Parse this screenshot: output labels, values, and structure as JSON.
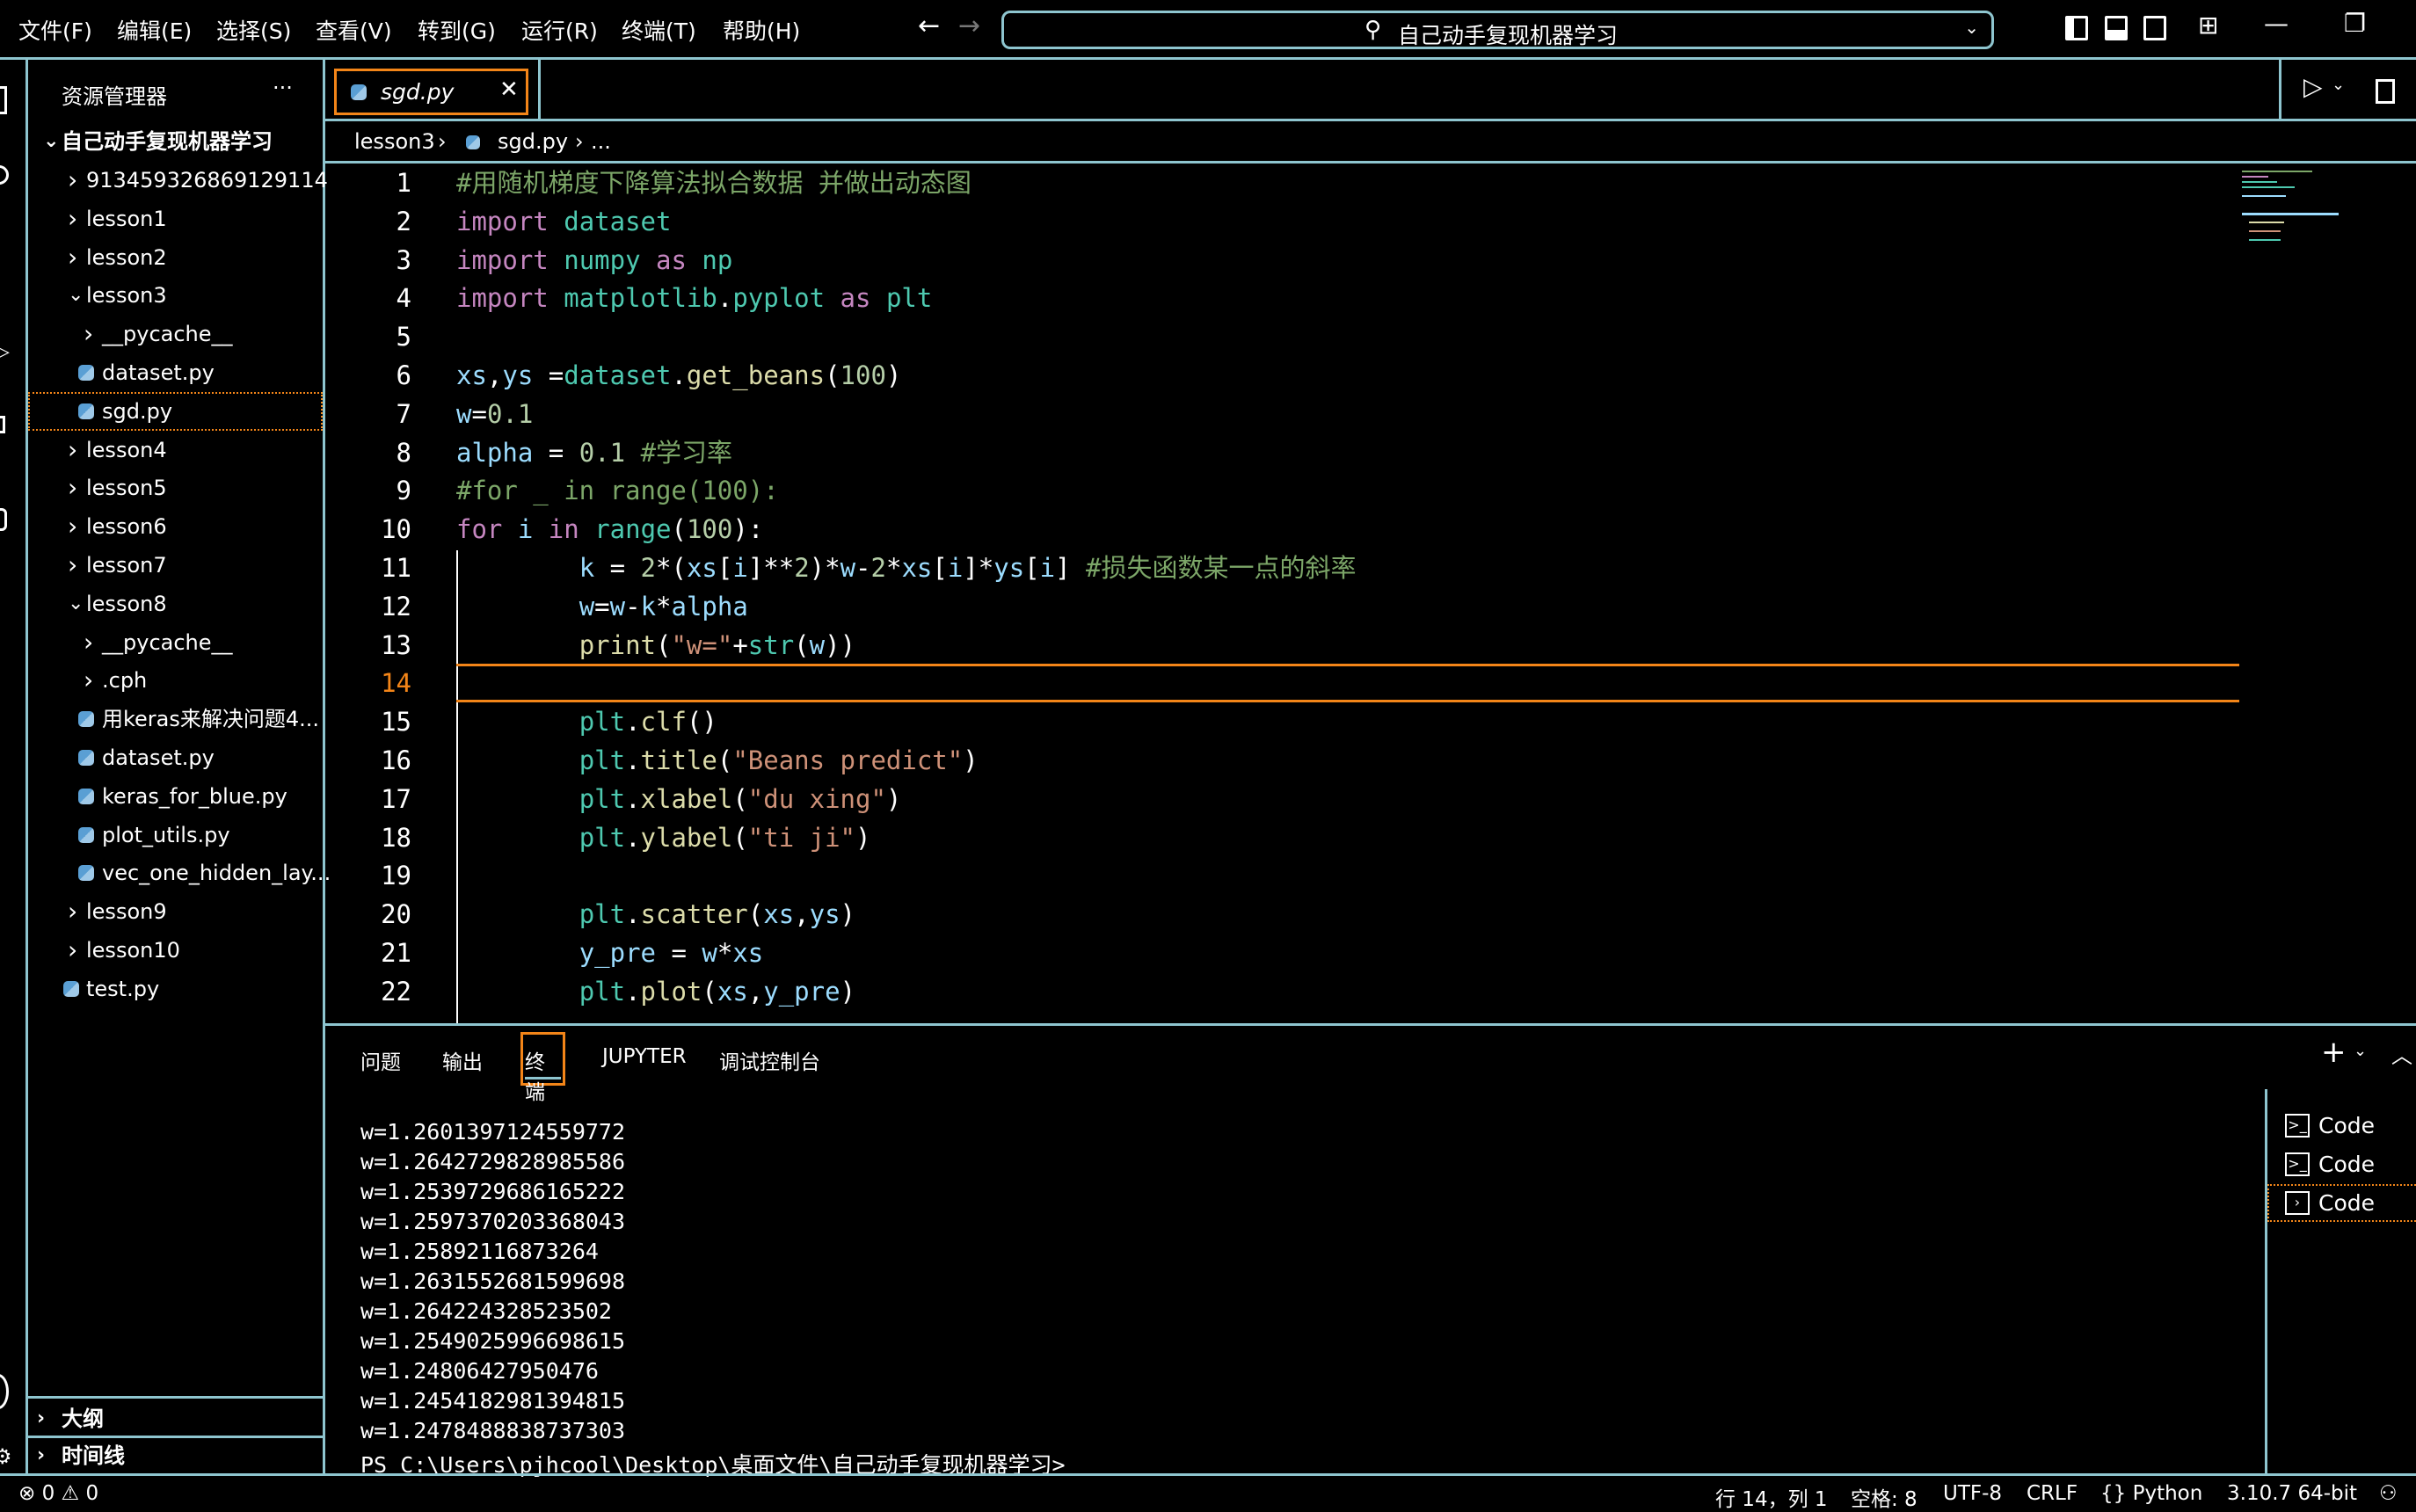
{
  "menu": [
    "文件(F)",
    "编辑(E)",
    "选择(S)",
    "查看(V)",
    "转到(G)",
    "运行(R)",
    "终端(T)",
    "帮助(H)"
  ],
  "command_center": {
    "text": "自己动手复现机器学习"
  },
  "sidebar": {
    "title": "资源管理器",
    "more": "···",
    "root": "自己动手复现机器学习",
    "items": [
      {
        "label": "913459326869129114",
        "type": "folder",
        "level": 1,
        "expanded": false
      },
      {
        "label": "lesson1",
        "type": "folder",
        "level": 1,
        "expanded": false
      },
      {
        "label": "lesson2",
        "type": "folder",
        "level": 1,
        "expanded": false
      },
      {
        "label": "lesson3",
        "type": "folder",
        "level": 1,
        "expanded": true
      },
      {
        "label": "__pycache__",
        "type": "folder",
        "level": 2,
        "expanded": false
      },
      {
        "label": "dataset.py",
        "type": "py",
        "level": 2
      },
      {
        "label": "sgd.py",
        "type": "py",
        "level": 2,
        "selected": true
      },
      {
        "label": "lesson4",
        "type": "folder",
        "level": 1,
        "expanded": false
      },
      {
        "label": "lesson5",
        "type": "folder",
        "level": 1,
        "expanded": false
      },
      {
        "label": "lesson6",
        "type": "folder",
        "level": 1,
        "expanded": false
      },
      {
        "label": "lesson7",
        "type": "folder",
        "level": 1,
        "expanded": false
      },
      {
        "label": "lesson8",
        "type": "folder",
        "level": 1,
        "expanded": true
      },
      {
        "label": "__pycache__",
        "type": "folder",
        "level": 2,
        "expanded": false
      },
      {
        "label": ".cph",
        "type": "folder",
        "level": 2,
        "expanded": false
      },
      {
        "label": "用keras来解决问题4...",
        "type": "py",
        "level": 2
      },
      {
        "label": "dataset.py",
        "type": "py",
        "level": 2
      },
      {
        "label": "keras_for_blue.py",
        "type": "py",
        "level": 2
      },
      {
        "label": "plot_utils.py",
        "type": "py",
        "level": 2
      },
      {
        "label": "vec_one_hidden_lay...",
        "type": "py",
        "level": 2
      },
      {
        "label": "lesson9",
        "type": "folder",
        "level": 1,
        "expanded": false
      },
      {
        "label": "lesson10",
        "type": "folder",
        "level": 1,
        "expanded": false
      },
      {
        "label": "test.py",
        "type": "py",
        "level": 0
      }
    ],
    "outline": "大纲",
    "timeline": "时间线"
  },
  "editor": {
    "tab": "sgd.py",
    "breadcrumb": [
      "lesson3",
      "sgd.py",
      "..."
    ],
    "current_line": 14,
    "lines": [
      [
        [
          "#用随机梯度下降算法拟合数据 并做出动态图",
          "cm"
        ]
      ],
      [
        [
          "import",
          "kw"
        ],
        [
          " ",
          "pl"
        ],
        [
          "dataset",
          "mod"
        ]
      ],
      [
        [
          "import",
          "kw"
        ],
        [
          " ",
          "pl"
        ],
        [
          "numpy",
          "mod"
        ],
        [
          " ",
          "pl"
        ],
        [
          "as",
          "kw"
        ],
        [
          " ",
          "pl"
        ],
        [
          "np",
          "mod"
        ]
      ],
      [
        [
          "import",
          "kw"
        ],
        [
          " ",
          "pl"
        ],
        [
          "matplotlib",
          "mod"
        ],
        [
          ".",
          "pl"
        ],
        [
          "pyplot",
          "mod"
        ],
        [
          " ",
          "pl"
        ],
        [
          "as",
          "kw"
        ],
        [
          " ",
          "pl"
        ],
        [
          "plt",
          "mod"
        ]
      ],
      [],
      [
        [
          "xs",
          "var"
        ],
        [
          ",",
          "pl"
        ],
        [
          "ys",
          "var"
        ],
        [
          " =",
          "pl"
        ],
        [
          "dataset",
          "mod"
        ],
        [
          ".",
          "pl"
        ],
        [
          "get_beans",
          "fn"
        ],
        [
          "(",
          "pl"
        ],
        [
          "100",
          "num"
        ],
        [
          ")",
          "pl"
        ]
      ],
      [
        [
          "w",
          "var"
        ],
        [
          "=",
          "pl"
        ],
        [
          "0.1",
          "num"
        ]
      ],
      [
        [
          "alpha",
          "var"
        ],
        [
          " = ",
          "pl"
        ],
        [
          "0.1",
          "num"
        ],
        [
          " ",
          "pl"
        ],
        [
          "#学习率",
          "cm"
        ]
      ],
      [
        [
          "#for _ in range(100):",
          "cm"
        ]
      ],
      [
        [
          "for",
          "kw"
        ],
        [
          " ",
          "pl"
        ],
        [
          "i",
          "var"
        ],
        [
          " ",
          "pl"
        ],
        [
          "in",
          "kw"
        ],
        [
          " ",
          "pl"
        ],
        [
          "range",
          "mod"
        ],
        [
          "(",
          "pl"
        ],
        [
          "100",
          "num"
        ],
        [
          "):",
          "pl"
        ]
      ],
      [
        [
          "        ",
          "pl"
        ],
        [
          "k",
          "var"
        ],
        [
          " = ",
          "pl"
        ],
        [
          "2",
          "num"
        ],
        [
          "*(",
          "pl"
        ],
        [
          "xs",
          "var"
        ],
        [
          "[",
          "pl"
        ],
        [
          "i",
          "var"
        ],
        [
          "]**",
          "pl"
        ],
        [
          "2",
          "num"
        ],
        [
          ")*",
          "pl"
        ],
        [
          "w",
          "var"
        ],
        [
          "-",
          "pl"
        ],
        [
          "2",
          "num"
        ],
        [
          "*",
          "pl"
        ],
        [
          "xs",
          "var"
        ],
        [
          "[",
          "pl"
        ],
        [
          "i",
          "var"
        ],
        [
          "]*",
          "pl"
        ],
        [
          "ys",
          "var"
        ],
        [
          "[",
          "pl"
        ],
        [
          "i",
          "var"
        ],
        [
          "]",
          "pl"
        ],
        [
          " ",
          "pl"
        ],
        [
          "#损失函数某一点的斜率",
          "cm"
        ]
      ],
      [
        [
          "        ",
          "pl"
        ],
        [
          "w",
          "var"
        ],
        [
          "=",
          "pl"
        ],
        [
          "w",
          "var"
        ],
        [
          "-",
          "pl"
        ],
        [
          "k",
          "var"
        ],
        [
          "*",
          "pl"
        ],
        [
          "alpha",
          "var"
        ]
      ],
      [
        [
          "        ",
          "pl"
        ],
        [
          "print",
          "fn"
        ],
        [
          "(",
          "pl"
        ],
        [
          "\"w=\"",
          "str"
        ],
        [
          "+",
          "pl"
        ],
        [
          "str",
          "mod"
        ],
        [
          "(",
          "pl"
        ],
        [
          "w",
          "var"
        ],
        [
          "))",
          "pl"
        ]
      ],
      [],
      [
        [
          "        ",
          "pl"
        ],
        [
          "plt",
          "mod"
        ],
        [
          ".",
          "pl"
        ],
        [
          "clf",
          "fn"
        ],
        [
          "()",
          "pl"
        ]
      ],
      [
        [
          "        ",
          "pl"
        ],
        [
          "plt",
          "mod"
        ],
        [
          ".",
          "pl"
        ],
        [
          "title",
          "fn"
        ],
        [
          "(",
          "pl"
        ],
        [
          "\"Beans predict\"",
          "str"
        ],
        [
          ")",
          "pl"
        ]
      ],
      [
        [
          "        ",
          "pl"
        ],
        [
          "plt",
          "mod"
        ],
        [
          ".",
          "pl"
        ],
        [
          "xlabel",
          "fn"
        ],
        [
          "(",
          "pl"
        ],
        [
          "\"du xing\"",
          "str"
        ],
        [
          ")",
          "pl"
        ]
      ],
      [
        [
          "        ",
          "pl"
        ],
        [
          "plt",
          "mod"
        ],
        [
          ".",
          "pl"
        ],
        [
          "ylabel",
          "fn"
        ],
        [
          "(",
          "pl"
        ],
        [
          "\"ti ji\"",
          "str"
        ],
        [
          ")",
          "pl"
        ]
      ],
      [],
      [
        [
          "        ",
          "pl"
        ],
        [
          "plt",
          "mod"
        ],
        [
          ".",
          "pl"
        ],
        [
          "scatter",
          "fn"
        ],
        [
          "(",
          "pl"
        ],
        [
          "xs",
          "var"
        ],
        [
          ",",
          "pl"
        ],
        [
          "ys",
          "var"
        ],
        [
          ")",
          "pl"
        ]
      ],
      [
        [
          "        ",
          "pl"
        ],
        [
          "y_pre",
          "var"
        ],
        [
          " = ",
          "pl"
        ],
        [
          "w",
          "var"
        ],
        [
          "*",
          "pl"
        ],
        [
          "xs",
          "var"
        ]
      ],
      [
        [
          "        ",
          "pl"
        ],
        [
          "plt",
          "mod"
        ],
        [
          ".",
          "pl"
        ],
        [
          "plot",
          "fn"
        ],
        [
          "(",
          "pl"
        ],
        [
          "xs",
          "var"
        ],
        [
          ",",
          "pl"
        ],
        [
          "y_pre",
          "var"
        ],
        [
          ")",
          "pl"
        ]
      ]
    ]
  },
  "panel": {
    "tabs": [
      "问题",
      "输出",
      "终端",
      "JUPYTER",
      "调试控制台"
    ],
    "active_tab": "终端",
    "terminal_lines": [
      "w=1.2601397124559772",
      "w=1.2642729828985586",
      "w=1.2539729686165222",
      "w=1.2597370203368043",
      "w=1.25892116873264",
      "w=1.2631552681599698",
      "w=1.264224328523502",
      "w=1.2549025996698615",
      "w=1.24806427950476",
      "w=1.2454182981394815",
      "w=1.2478488838737303",
      "PS C:\\Users\\pjhcool\\Desktop\\桌面文件\\自己动手复现机器学习>"
    ],
    "terminals": [
      "Code",
      "Code",
      "Code"
    ]
  },
  "status": {
    "errors": "0",
    "warnings": "0",
    "position": "行 14，列 1",
    "spaces": "空格: 8",
    "encoding": "UTF-8",
    "eol": "CRLF",
    "language": "Python",
    "interpreter": "3.10.7 64-bit"
  },
  "colors": {
    "border": "#8ec5cf",
    "focus": "#f38518",
    "keyword": "#c586c0",
    "module": "#4ec9b0",
    "variable": "#9cdcfe",
    "comment": "#7ca668",
    "number": "#b5cea8",
    "string": "#ce9178",
    "function": "#dcdcaa"
  }
}
